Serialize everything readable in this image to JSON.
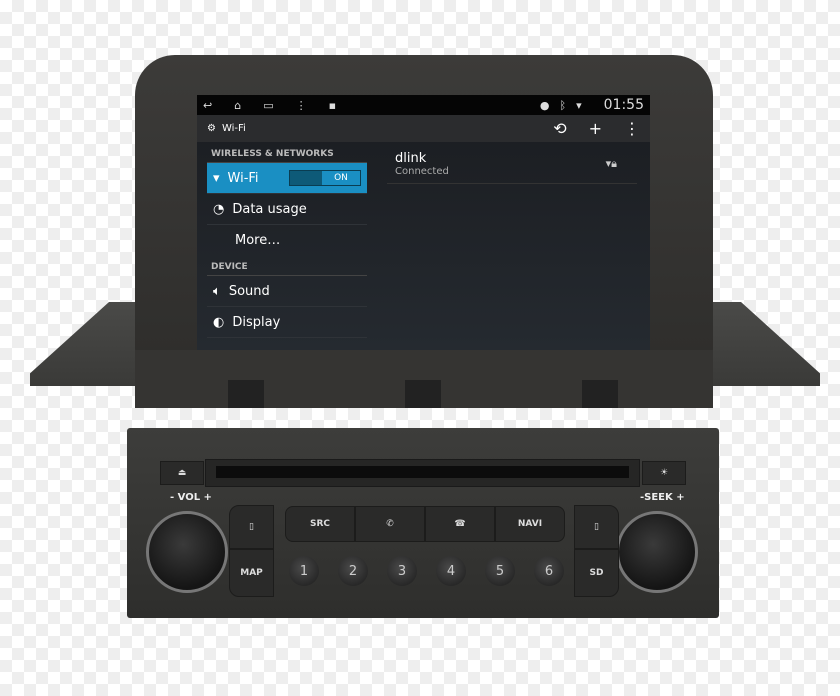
{
  "status_bar": {
    "time": "01:55",
    "icons": [
      "back-icon",
      "home-icon",
      "recent-apps-icon",
      "overflow-icon",
      "notification-icon",
      "location-icon",
      "bluetooth-icon",
      "wifi-icon"
    ]
  },
  "action_bar": {
    "title": "Wi-Fi",
    "icons": [
      "refresh-icon",
      "add-icon",
      "overflow-icon"
    ]
  },
  "settings": {
    "section1": "WIRELESS & NETWORKS",
    "wifi": "Wi-Fi",
    "toggle": "ON",
    "data_usage": "Data usage",
    "more": "More…",
    "section2": "DEVICE",
    "sound": "Sound",
    "display": "Display"
  },
  "network": {
    "name": "dlink",
    "status": "Connected"
  },
  "accent": "#1a8fc3",
  "radio": {
    "vol": "- VOL +",
    "seek": "-SEEK +",
    "src": "SRC",
    "navi": "NAVI",
    "map": "MAP",
    "presets": [
      "1",
      "2",
      "3",
      "4",
      "5",
      "6"
    ]
  }
}
